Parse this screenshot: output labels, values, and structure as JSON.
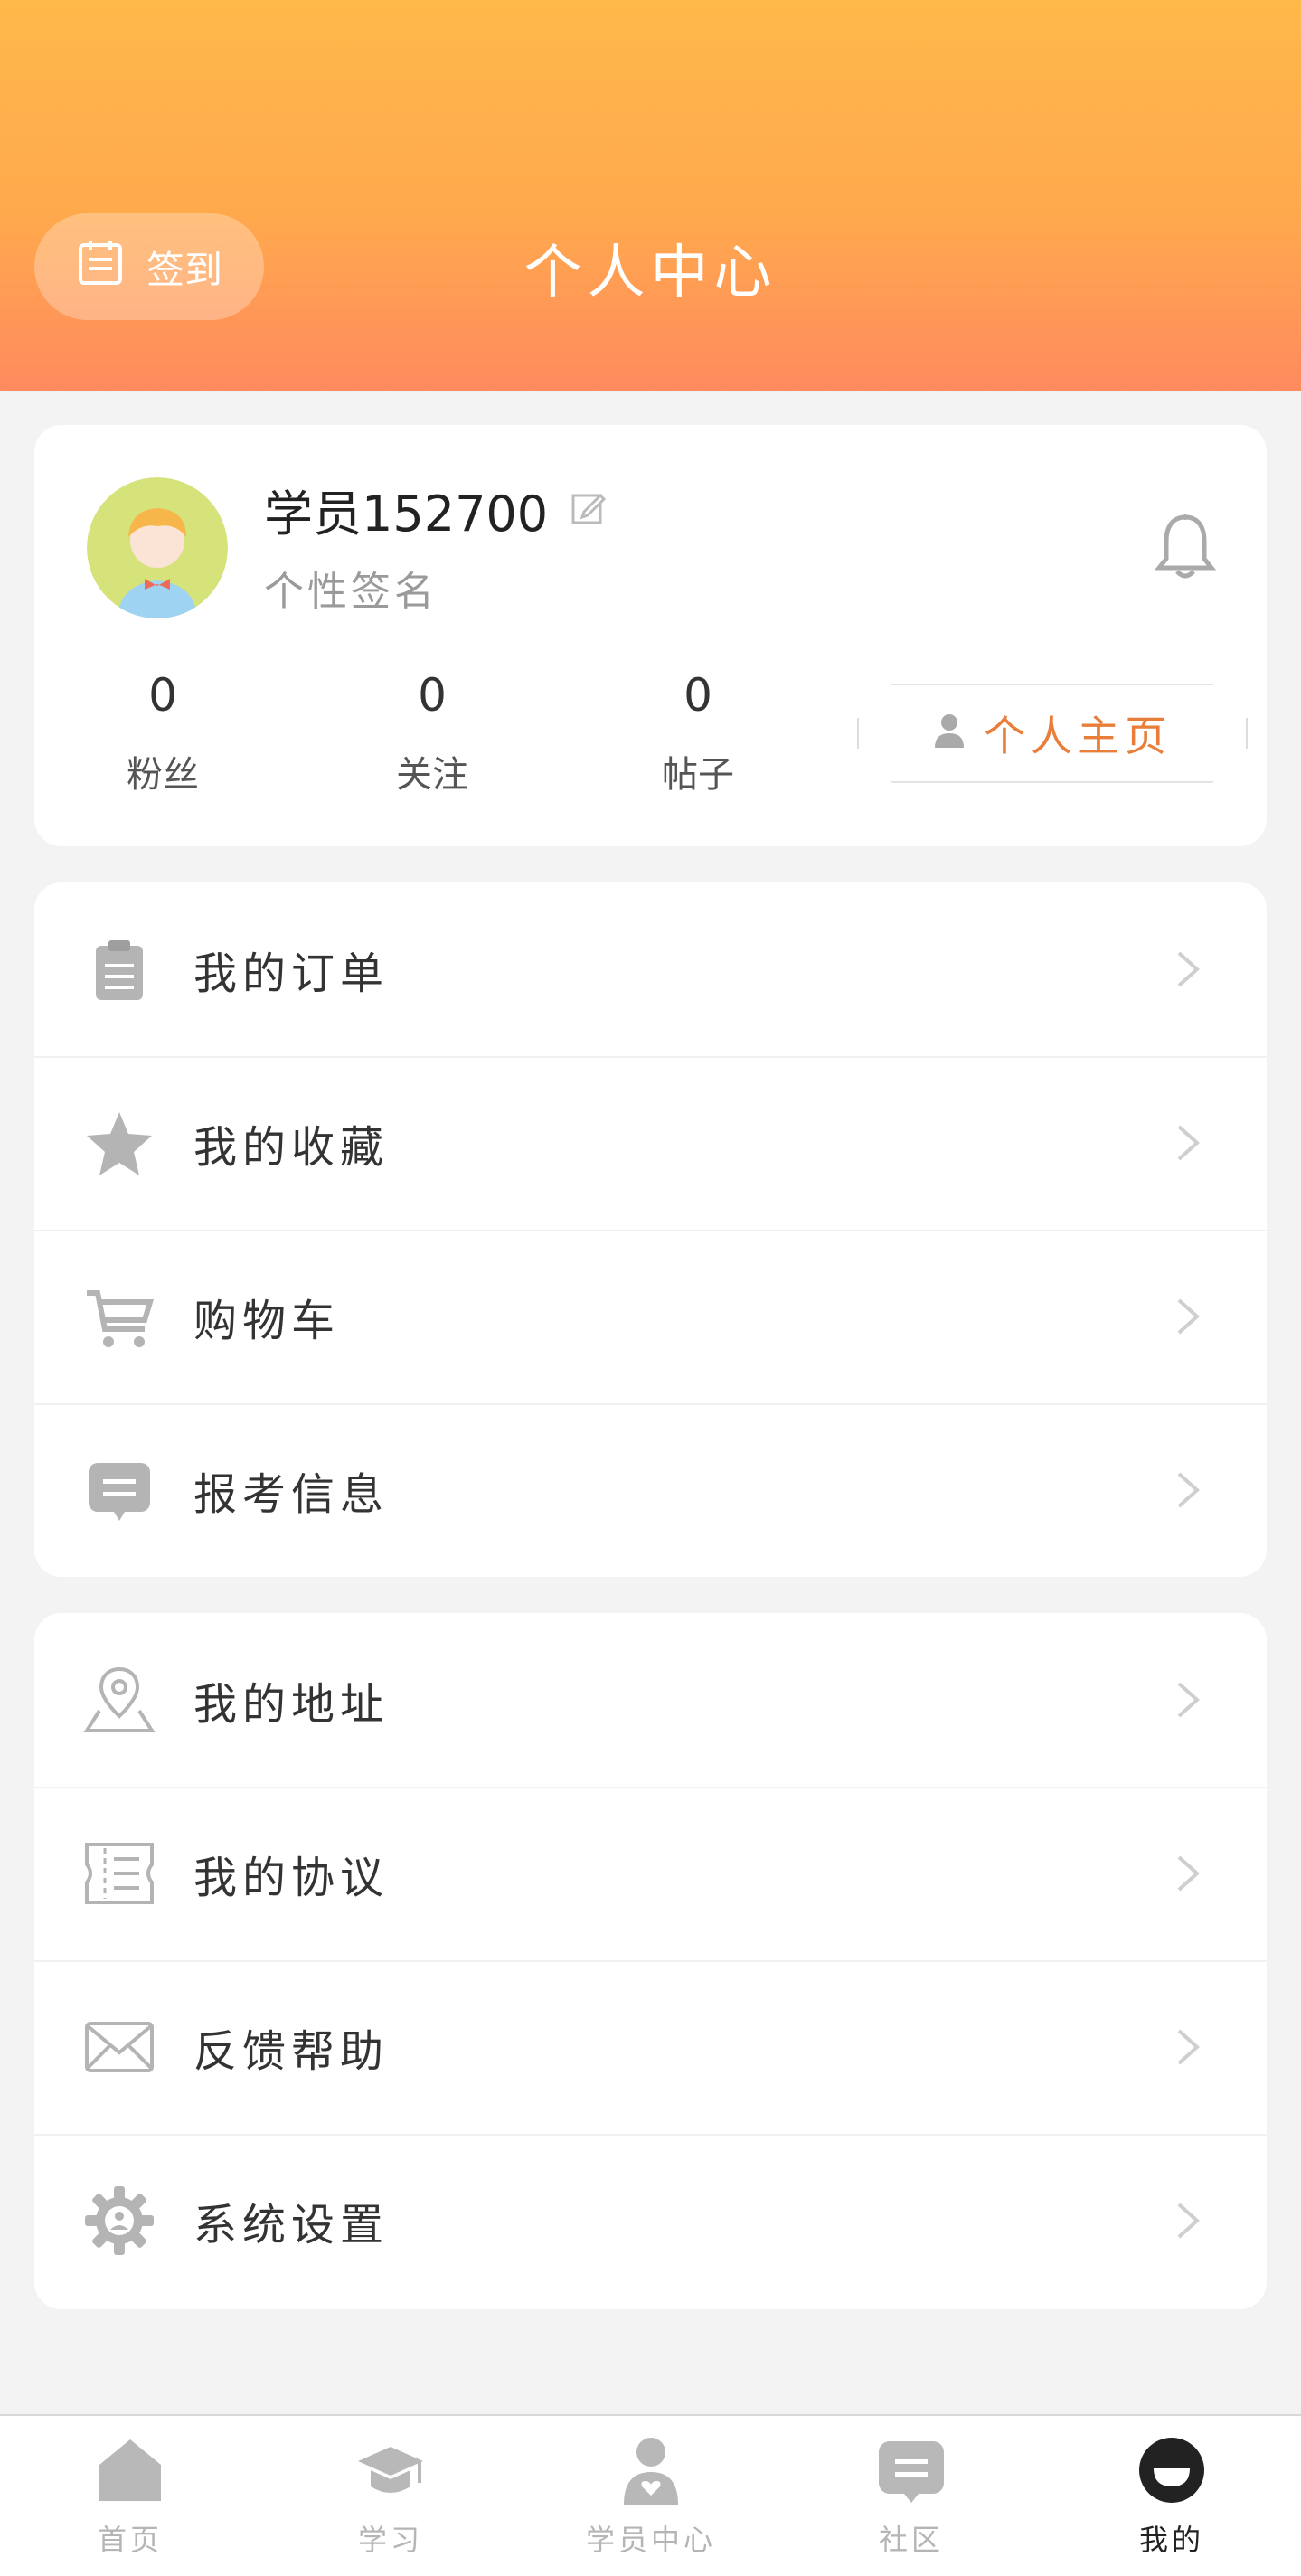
{
  "header": {
    "title": "个人中心",
    "checkin_label": "签到",
    "gradient_top": "#ffb84a",
    "gradient_bottom": "#ff8a5e"
  },
  "profile": {
    "username": "学员152700",
    "signature": "个性签名",
    "stats": [
      {
        "value": "0",
        "label": "粉丝"
      },
      {
        "value": "0",
        "label": "关注"
      },
      {
        "value": "0",
        "label": "帖子"
      }
    ],
    "homepage_label": "个人主页",
    "accent": "#e97e3a"
  },
  "menu_group_1": [
    {
      "label": "我的订单",
      "icon": "clipboard-icon"
    },
    {
      "label": "我的收藏",
      "icon": "star-icon"
    },
    {
      "label": "购物车",
      "icon": "cart-icon"
    },
    {
      "label": "报考信息",
      "icon": "message-icon"
    }
  ],
  "menu_group_2": [
    {
      "label": "我的地址",
      "icon": "location-icon"
    },
    {
      "label": "我的协议",
      "icon": "agreement-icon"
    },
    {
      "label": "反馈帮助",
      "icon": "mail-icon"
    },
    {
      "label": "系统设置",
      "icon": "settings-icon"
    }
  ],
  "tabbar": [
    {
      "label": "首页",
      "icon": "home-icon"
    },
    {
      "label": "学习",
      "icon": "graduation-cap-icon"
    },
    {
      "label": "学员中心",
      "icon": "student-center-icon"
    },
    {
      "label": "社区",
      "icon": "community-icon"
    },
    {
      "label": "我的",
      "icon": "me-icon",
      "active": true
    }
  ]
}
